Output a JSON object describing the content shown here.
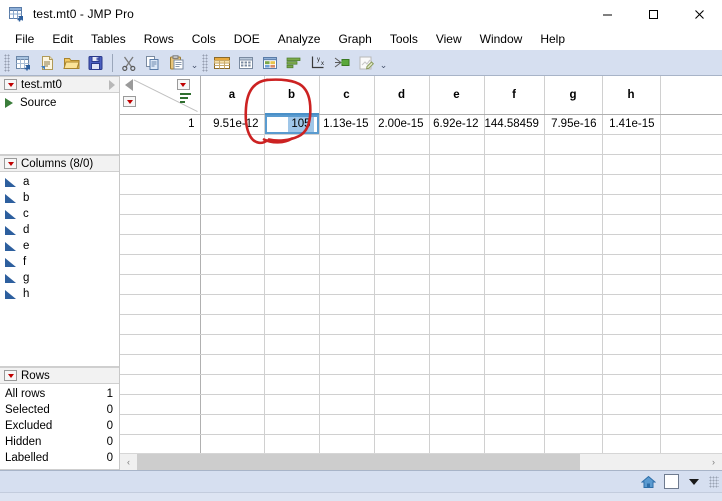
{
  "window": {
    "title": "test.mt0 - JMP Pro",
    "app_icon": "jmp-table-icon",
    "minimize": "–",
    "maximize": "□",
    "close": "✕"
  },
  "menubar": {
    "items": [
      {
        "label": "File"
      },
      {
        "label": "Edit"
      },
      {
        "label": "Tables"
      },
      {
        "label": "Rows"
      },
      {
        "label": "Cols"
      },
      {
        "label": "DOE"
      },
      {
        "label": "Analyze"
      },
      {
        "label": "Graph"
      },
      {
        "label": "Tools"
      },
      {
        "label": "View"
      },
      {
        "label": "Window"
      },
      {
        "label": "Help"
      }
    ]
  },
  "toolbar": {
    "group1": [
      {
        "icon": "new-data-table-icon"
      },
      {
        "icon": "new-script-icon"
      },
      {
        "icon": "open-folder-icon"
      },
      {
        "icon": "save-icon"
      }
    ],
    "group2": [
      {
        "icon": "cut-scissors-icon"
      },
      {
        "icon": "copy-icon"
      },
      {
        "icon": "paste-icon"
      }
    ],
    "group3": [
      {
        "icon": "data-table-icon"
      },
      {
        "icon": "column-viewer-icon"
      },
      {
        "icon": "subset-icon"
      },
      {
        "icon": "distribution-icon"
      },
      {
        "icon": "fit-y-by-x-icon"
      },
      {
        "icon": "fit-model-icon"
      },
      {
        "icon": "graph-builder-icon"
      }
    ],
    "overflow_caret": "⌄"
  },
  "sidebar": {
    "table_panel": {
      "title": "test.mt0",
      "menu_icon": "red-triangle-menu",
      "expand_icon": "chevron-right-icon",
      "items": [
        {
          "label": "Source",
          "icon": "green-run-triangle"
        }
      ]
    },
    "columns_panel": {
      "title": "Columns (8/0)",
      "menu_icon": "red-triangle-menu",
      "items": [
        {
          "label": "a",
          "icon": "continuous-column-icon"
        },
        {
          "label": "b",
          "icon": "continuous-column-icon"
        },
        {
          "label": "c",
          "icon": "continuous-column-icon"
        },
        {
          "label": "d",
          "icon": "continuous-column-icon"
        },
        {
          "label": "e",
          "icon": "continuous-column-icon"
        },
        {
          "label": "f",
          "icon": "continuous-column-icon"
        },
        {
          "label": "g",
          "icon": "continuous-column-icon"
        },
        {
          "label": "h",
          "icon": "continuous-column-icon"
        }
      ]
    },
    "rows_panel": {
      "title": "Rows",
      "menu_icon": "red-triangle-menu",
      "stats": [
        {
          "label": "All rows",
          "value": "1"
        },
        {
          "label": "Selected",
          "value": "0"
        },
        {
          "label": "Excluded",
          "value": "0"
        },
        {
          "label": "Hidden",
          "value": "0"
        },
        {
          "label": "Labelled",
          "value": "0"
        }
      ]
    }
  },
  "grid": {
    "corner": {
      "collapse_icon": "left-triangle-icon",
      "rows_menu_icon": "red-triangle-menu",
      "cols_menu_icon": "red-triangle-menu",
      "sort_icon": "sort-bars-icon"
    },
    "columns": [
      "a",
      "b",
      "c",
      "d",
      "e",
      "f",
      "g",
      "h"
    ],
    "rows": [
      {
        "number": "1",
        "cells": [
          "9.51e-12",
          "105",
          "1.13e-15",
          "2.00e-15",
          "6.92e-12",
          "144.58459",
          "7.95e-16",
          "1.41e-15"
        ]
      }
    ],
    "selected_cell": {
      "row": "1",
      "column": "b",
      "value": "105"
    },
    "empty_row_count": 17,
    "annotation": {
      "type": "hand-drawn-ellipse",
      "color": "#cc2222",
      "target": "column-b-header-and-cell"
    }
  },
  "scrollbar": {
    "left_arrow": "‹",
    "right_arrow": "›"
  },
  "statusbar": {
    "text": "",
    "home_icon": "home-icon",
    "window_button": "window-square-icon",
    "dropdown_icon": "caret-down-icon",
    "resize_grip": "resize-grip-icon"
  },
  "colors": {
    "toolbar_bg": "#d6dff0",
    "accent_blue": "#2d5f9e",
    "selection_blue": "#9fc6e8",
    "annotation_red": "#cc2222",
    "menu_red": "#c00000"
  }
}
